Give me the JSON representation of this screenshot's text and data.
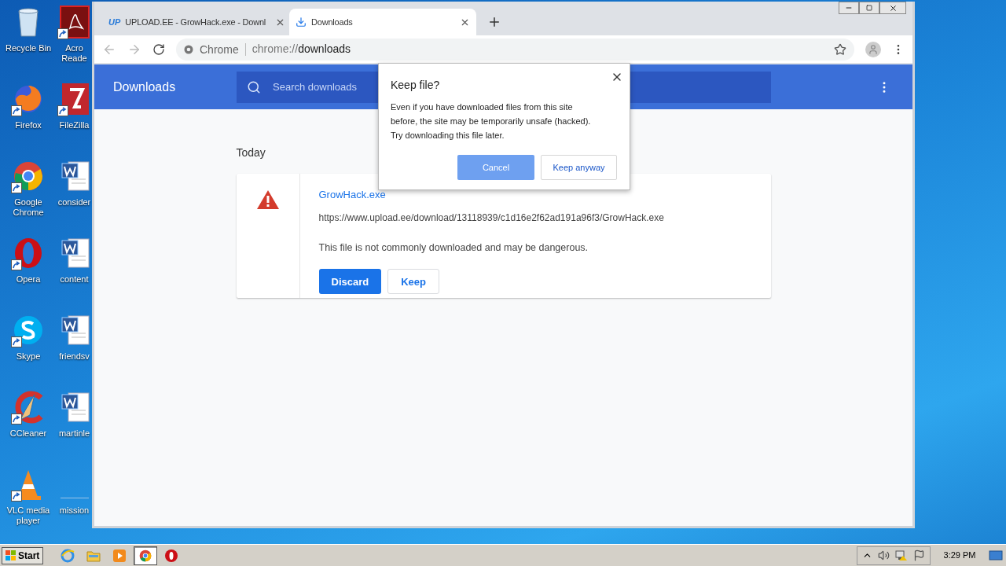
{
  "desktop": {
    "columns": [
      [
        {
          "label": "Recycle Bin",
          "kind": "bin"
        },
        {
          "label": "Firefox",
          "kind": "firefox"
        },
        {
          "label": "Google Chrome",
          "kind": "chrome"
        },
        {
          "label": "Opera",
          "kind": "opera"
        },
        {
          "label": "Skype",
          "kind": "skype"
        },
        {
          "label": "CCleaner",
          "kind": "ccleaner"
        },
        {
          "label": "VLC media player",
          "kind": "vlc"
        }
      ],
      [
        {
          "label": "Acro Reade",
          "kind": "acrobat"
        },
        {
          "label": "FileZilla",
          "kind": "filezilla"
        },
        {
          "label": "consider",
          "kind": "word"
        },
        {
          "label": "content",
          "kind": "word"
        },
        {
          "label": "friendsv",
          "kind": "word"
        },
        {
          "label": "martinle",
          "kind": "word"
        },
        {
          "label": "mission",
          "kind": "blank"
        }
      ]
    ]
  },
  "browser": {
    "tabs": [
      {
        "title": "UPLOAD.EE - GrowHack.exe - Downl",
        "favicon": "UP",
        "selected": false
      },
      {
        "title": "Downloads",
        "selected": true
      }
    ],
    "address": {
      "site": "Chrome",
      "scheme": "chrome://",
      "host": "downloads"
    },
    "page": {
      "title": "Downloads",
      "search_placeholder": "Search downloads",
      "date_heading": "Today",
      "item": {
        "file_name": "GrowHack.exe",
        "url": "https://www.upload.ee/download/13118939/c1d16e2f62ad191a96f3/GrowHack.exe",
        "warning": "This file is not commonly downloaded and may be dangerous.",
        "buttons": [
          {
            "label": "Discard",
            "kind": "primary"
          },
          {
            "label": "Keep",
            "kind": "secondary"
          }
        ]
      }
    },
    "dialog": {
      "title": "Keep file?",
      "message": "Even if you have downloaded files from this site before, the site may be temporarily unsafe (hacked). Try downloading this file later.",
      "buttons": [
        {
          "label": "Cancel",
          "kind": "primary"
        },
        {
          "label": "Keep anyway",
          "kind": "secondary"
        }
      ]
    }
  },
  "taskbar": {
    "start": "Start",
    "apps": [
      {
        "kind": "ie",
        "selected": false
      },
      {
        "kind": "explorer",
        "selected": false
      },
      {
        "kind": "media",
        "selected": false
      },
      {
        "kind": "chrome",
        "selected": true
      },
      {
        "kind": "opera",
        "selected": false
      }
    ],
    "clock": "3:29 PM"
  }
}
